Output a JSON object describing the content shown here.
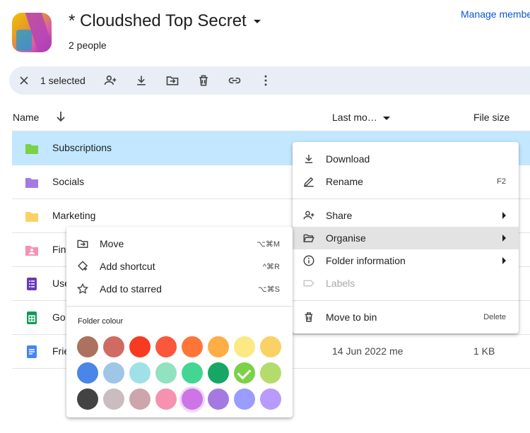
{
  "header": {
    "title": "* Cloudshed Top Secret",
    "people": "2 people",
    "manage": "Manage members"
  },
  "toolbar": {
    "selected": "1 selected",
    "icons": [
      "close-icon",
      "add-person-icon",
      "download-icon",
      "move-to-folder-icon",
      "delete-icon",
      "link-icon",
      "more-vert-icon"
    ]
  },
  "columns": {
    "name": "Name",
    "last_modified": "Last mo…",
    "file_size": "File size"
  },
  "rows": [
    {
      "name": "Subscriptions",
      "icon": "folder-green",
      "modified": "",
      "size": "",
      "selected": true
    },
    {
      "name": "Socials",
      "icon": "folder-purple",
      "modified": "",
      "size": ""
    },
    {
      "name": "Marketing",
      "icon": "folder-yellow",
      "modified": "",
      "size": ""
    },
    {
      "name": "Fin",
      "icon": "shared-folder-pink",
      "modified": "",
      "size": ""
    },
    {
      "name": "Use",
      "icon": "forms-icon",
      "modified": "",
      "size": ""
    },
    {
      "name": "Go",
      "icon": "sheets-icon",
      "modified": "",
      "size": ""
    },
    {
      "name": "Frie",
      "icon": "docs-icon",
      "modified": "14 Jun 2022 me",
      "size": "1 KB"
    }
  ],
  "context_menu": {
    "items": [
      {
        "label": "Download",
        "icon": "download-icon",
        "shortcut": ""
      },
      {
        "label": "Rename",
        "icon": "edit-icon",
        "shortcut": "F2"
      },
      {
        "label": "Share",
        "icon": "add-person-icon",
        "submenu": true
      },
      {
        "label": "Organise",
        "icon": "folder-open-icon",
        "submenu": true,
        "highlighted": true
      },
      {
        "label": "Folder information",
        "icon": "info-icon",
        "submenu": true
      },
      {
        "label": "Labels",
        "icon": "label-icon",
        "disabled": true
      },
      {
        "label": "Move to bin",
        "icon": "delete-icon",
        "shortcut": "Delete"
      }
    ]
  },
  "organise_menu": {
    "items": [
      {
        "label": "Move",
        "icon": "move-to-folder-icon",
        "shortcut": "⌥⌘M"
      },
      {
        "label": "Add shortcut",
        "icon": "add-shortcut-icon",
        "shortcut": "^⌘R"
      },
      {
        "label": "Add to starred",
        "icon": "star-icon",
        "shortcut": "⌥⌘S"
      }
    ],
    "folder_colour_label": "Folder colour",
    "colours": [
      [
        "#ac725e",
        "#d06b64",
        "#f83a22",
        "#fa573c",
        "#ff7537",
        "#ffad46",
        "#fbe983",
        "#fad165"
      ],
      [
        "#4986e7",
        "#9fc6e7",
        "#9fe1e7",
        "#92e1c0",
        "#42d692",
        "#16a765",
        "#7bd148",
        "#b3dc6c"
      ],
      [
        "#434343",
        "#cabdbf",
        "#cca6ac",
        "#f691b2",
        "#cd74e6",
        "#a47ae2",
        "#9a9cff",
        "#b99aff"
      ]
    ],
    "checked_colour": "#7bd148",
    "hovered_colour": "#cd74e6"
  }
}
